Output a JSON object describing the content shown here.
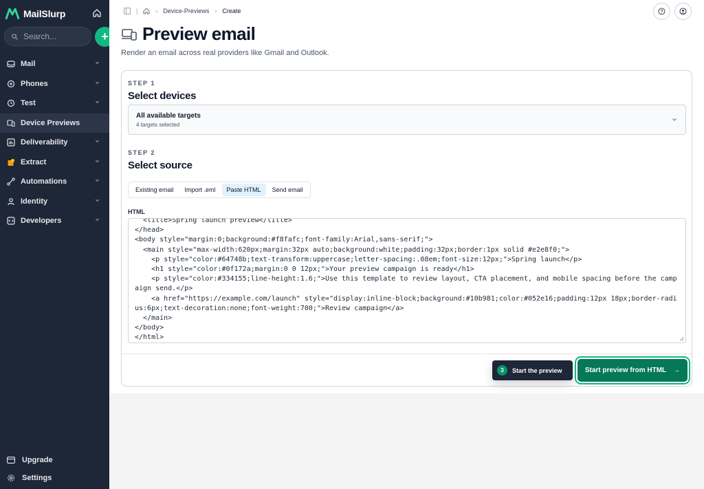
{
  "sidebar": {
    "brand": "MailSlurp",
    "search_placeholder": "Search...",
    "add_label": "+",
    "nav": [
      {
        "label": "Mail",
        "icon": "inbox-icon",
        "active": false
      },
      {
        "label": "Phones",
        "icon": "phone-icon",
        "active": false
      },
      {
        "label": "Test",
        "icon": "clock-icon",
        "active": false
      },
      {
        "label": "Device Previews",
        "icon": "devices-icon",
        "active": true
      },
      {
        "label": "Deliverability",
        "icon": "chart-icon",
        "active": false
      },
      {
        "label": "Extract",
        "icon": "puzzle-icon",
        "active": false
      },
      {
        "label": "Automations",
        "icon": "workflow-icon",
        "active": false
      },
      {
        "label": "Identity",
        "icon": "user-icon",
        "active": false
      },
      {
        "label": "Developers",
        "icon": "code-icon",
        "active": false
      }
    ],
    "bottom": [
      {
        "label": "Upgrade",
        "icon": "credit-card-icon"
      },
      {
        "label": "Settings",
        "icon": "gear-icon"
      }
    ]
  },
  "breadcrumb": {
    "items": [
      "Device-Previews",
      "Create"
    ]
  },
  "page": {
    "title": "Preview email",
    "subtitle": "Render an email across real providers like Gmail and Outlook."
  },
  "step1": {
    "label": "STEP 1",
    "title": "Select devices",
    "select_title": "All available targets",
    "select_sub": "4 targets selected"
  },
  "step2": {
    "label": "STEP 2",
    "title": "Select source",
    "tabs": [
      {
        "label": "Existing email",
        "active": false
      },
      {
        "label": "Import .eml",
        "active": false
      },
      {
        "label": "Paste HTML",
        "active": true
      },
      {
        "label": "Send email",
        "active": false
      }
    ],
    "html_label": "HTML",
    "html_value": "  <title>Spring launch preview</title>\n</head>\n<body style=\"margin:0;background:#f8fafc;font-family:Arial,sans-serif;\">\n  <main style=\"max-width:620px;margin:32px auto;background:white;padding:32px;border:1px solid #e2e8f0;\">\n    <p style=\"color:#64748b;text-transform:uppercase;letter-spacing:.08em;font-size:12px;\">Spring launch</p>\n    <h1 style=\"color:#0f172a;margin:0 0 12px;\">Your preview campaign is ready</h1>\n    <p style=\"color:#334155;line-height:1.6;\">Use this template to review layout, CTA placement, and mobile spacing before the campaign send.</p>\n    <a href=\"https://example.com/launch\" style=\"display:inline-block;background:#10b981;color:#052e16;padding:12px 18px;border-radius:6px;text-decoration:none;font-weight:700;\">Review campaign</a>\n  </main>\n</body>\n</html>"
  },
  "actions": {
    "tour_step": "3",
    "tour_label": "Start the preview",
    "primary_label": "Start preview from HTML",
    "primary_arrow": "→"
  },
  "colors": {
    "sidebar_bg": "#1e2737",
    "accent": "#10b981",
    "primary_button": "#047857",
    "active_tab": "#e0f2fe"
  }
}
